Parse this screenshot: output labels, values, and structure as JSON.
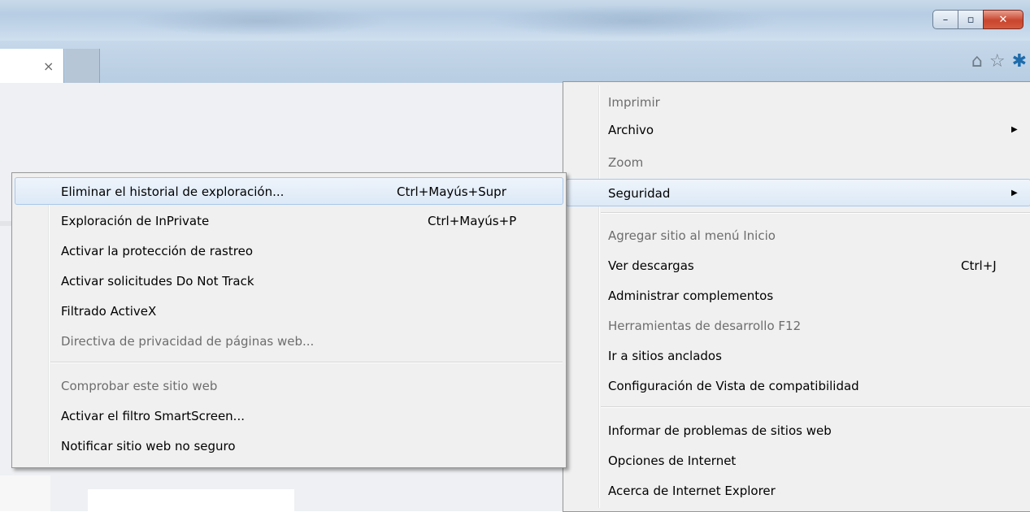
{
  "window": {
    "buttons": {
      "minimize": "–",
      "maximize": "▫",
      "close": "✕"
    }
  },
  "tabbar": {
    "tab_close": "×",
    "icons": [
      "home-icon",
      "star-icon",
      "gear-icon"
    ],
    "home_glyph": "⌂",
    "star_glyph": "☆",
    "gear_glyph": "✱"
  },
  "tools_menu": {
    "items": [
      {
        "label": "Imprimir",
        "disabled": true
      },
      {
        "label": "Archivo",
        "submenu": true
      },
      {
        "label": "Zoom",
        "disabled": true
      },
      {
        "label": "Seguridad",
        "submenu": true,
        "highlighted": true
      },
      {
        "label": "Agregar sitio al menú Inicio",
        "disabled": true
      },
      {
        "label": "Ver descargas",
        "shortcut": "Ctrl+J"
      },
      {
        "label": "Administrar complementos"
      },
      {
        "label": "Herramientas de desarrollo F12",
        "disabled": true
      },
      {
        "label": "Ir a sitios anclados"
      },
      {
        "label": "Configuración de Vista de compatibilidad"
      },
      {
        "label": "Informar de problemas de sitios web"
      },
      {
        "label": "Opciones de Internet"
      },
      {
        "label": "Acerca de Internet Explorer"
      }
    ]
  },
  "security_submenu": {
    "items": [
      {
        "label": "Eliminar el historial de exploración...",
        "shortcut": "Ctrl+Mayús+Supr",
        "highlighted": true
      },
      {
        "label": "Exploración de InPrivate",
        "shortcut": "Ctrl+Mayús+P"
      },
      {
        "label": "Activar la protección de rastreo"
      },
      {
        "label": "Activar solicitudes Do Not Track"
      },
      {
        "label": "Filtrado ActiveX"
      },
      {
        "label": "Directiva de privacidad de páginas web...",
        "disabled": true
      },
      {
        "label": "Comprobar este sitio web",
        "disabled": true
      },
      {
        "label": "Activar el filtro SmartScreen..."
      },
      {
        "label": "Notificar sitio web no seguro"
      }
    ]
  },
  "colors": {
    "menu_bg": "#f0f0f0",
    "highlight_border": "#a8c7ea",
    "disabled_text": "#6d6d6d",
    "gear_icon": "#1e6cab"
  }
}
